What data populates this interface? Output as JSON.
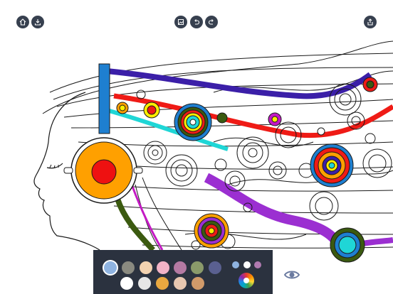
{
  "toolbar": {
    "left": [
      {
        "name": "home-icon"
      },
      {
        "name": "download-icon"
      }
    ],
    "center": [
      {
        "name": "gallery-icon"
      },
      {
        "name": "undo-icon"
      },
      {
        "name": "redo-icon"
      }
    ],
    "right": [
      {
        "name": "share-icon"
      }
    ],
    "button_color": "#37404f"
  },
  "palette": {
    "background": "#2b323f",
    "selected_index": 0,
    "row1": [
      "#8fb3e0",
      "#8a8a80",
      "#f2d2b0",
      "#f2b3c6",
      "#b57aa3",
      "#8a9a6a",
      "#5a6090"
    ],
    "row2": [
      "#ffffff",
      "#e6e6e6",
      "#e9a840",
      "#e8c7b0",
      "#d19a6a",
      "#f2da60"
    ],
    "mini_swatches": [
      "#8fb3e0",
      "#ffffff",
      "#b07ab0"
    ],
    "color_wheel_icon": "color-wheel-icon"
  },
  "preview": {
    "icon": "eye-icon",
    "color": "#6a7aa0"
  }
}
